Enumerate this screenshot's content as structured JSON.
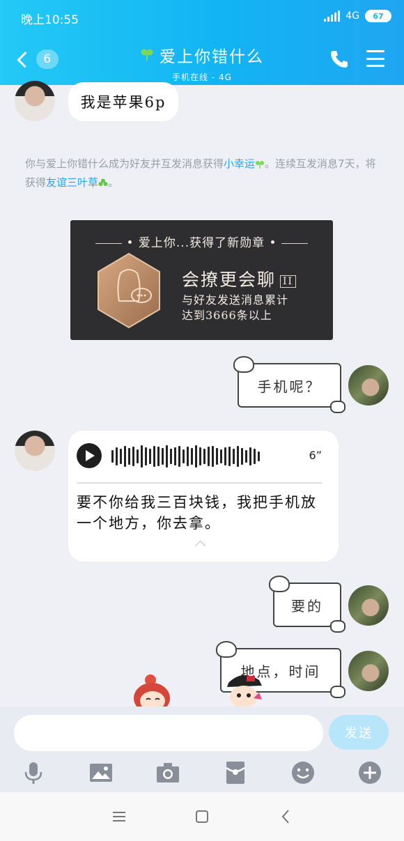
{
  "status": {
    "time": "晚上10:55",
    "network": "4G",
    "battery": "67"
  },
  "header": {
    "back_count": "6",
    "title": "爱上你错什么",
    "subtitle": "手机在线 - 4G"
  },
  "messages": {
    "m1": "我是苹果6p",
    "system": {
      "p1": "你与爱上你错什么成为好友并互发消息获得",
      "link1": "小幸运",
      "p2": "。连续互发消息7天，将获得",
      "link2": "友谊三叶草",
      "p3": "。"
    },
    "medal": {
      "header": "爱上你...获得了新勋章",
      "name": "会撩更会聊",
      "level": "II",
      "desc1": "与好友发送消息累计",
      "desc2": "达到3666条以上"
    },
    "m2": "手机呢？",
    "voice": {
      "duration": "6”",
      "text": "要不你给我三百块钱，我把手机放一个地方，你去拿。"
    },
    "m3": "要的",
    "m4": "地点，时间"
  },
  "input": {
    "send_label": "发送"
  },
  "icons": [
    "microphone-icon",
    "image-icon",
    "camera-icon",
    "red-packet-icon",
    "emoji-icon",
    "plus-icon"
  ],
  "colors": {
    "header": "#12b4f3",
    "link": "#2ba3e8",
    "send_disabled": "#b7e6fb"
  }
}
